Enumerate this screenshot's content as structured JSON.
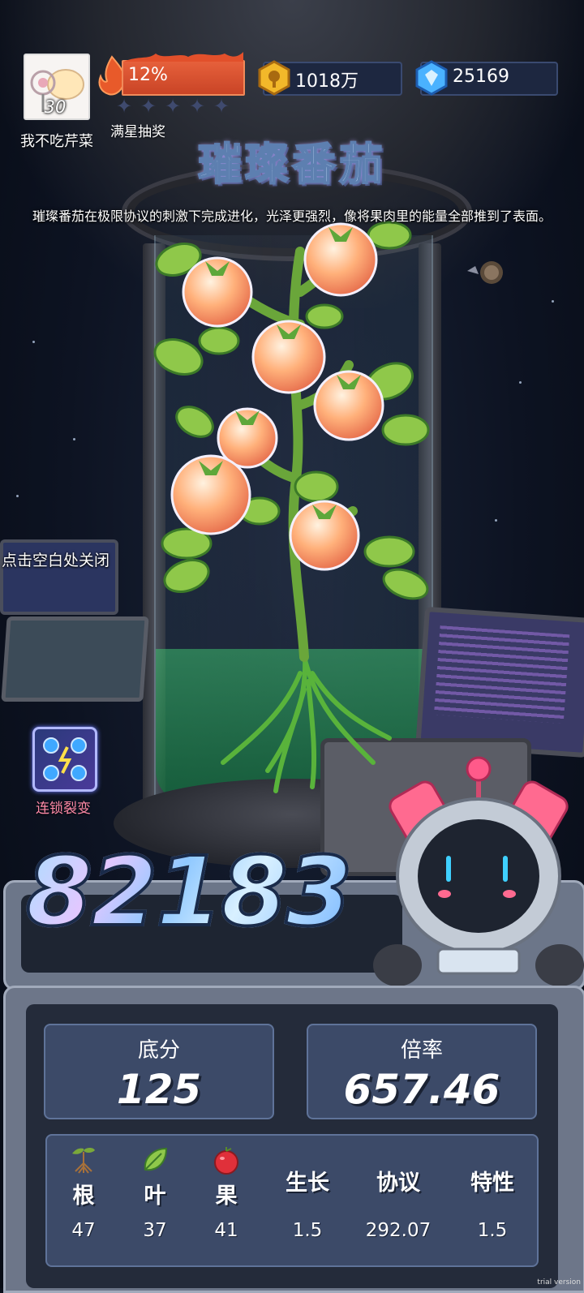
{
  "player": {
    "name": "我不吃芹菜",
    "level": "30"
  },
  "lottery": {
    "progress_text": "12%",
    "progress": 0.12,
    "label": "满星抽奖",
    "stars_filled": 0,
    "stars_total": 5
  },
  "resources": {
    "coins": "1018万",
    "gems": "25169"
  },
  "plant": {
    "title": "璀璨番茄",
    "description": "璀璨番茄在极限协议的刺激下完成进化，光泽更强烈，像将果肉里的能量全部推到了表面。"
  },
  "hint": {
    "close": "点击空白处关闭"
  },
  "chain": {
    "label": "连锁裂变"
  },
  "score": {
    "total": "82183"
  },
  "stats": {
    "base_label": "底分",
    "base_value": "125",
    "mult_label": "倍率",
    "mult_value": "657.46"
  },
  "table": {
    "columns": [
      {
        "label": "根",
        "icon": "root-icon",
        "value": "47"
      },
      {
        "label": "叶",
        "icon": "leaf-icon",
        "value": "37"
      },
      {
        "label": "果",
        "icon": "fruit-icon",
        "value": "41"
      },
      {
        "label": "生长",
        "value": "1.5"
      },
      {
        "label": "协议",
        "value": "292.07"
      },
      {
        "label": "特性",
        "value": "1.5"
      }
    ]
  },
  "watermark": "trial version",
  "colors": {
    "fire_bar": "#e6603b",
    "panel": "#6d7689",
    "stat_box": "#3c4a68",
    "chain_text": "#ff8aa8"
  }
}
